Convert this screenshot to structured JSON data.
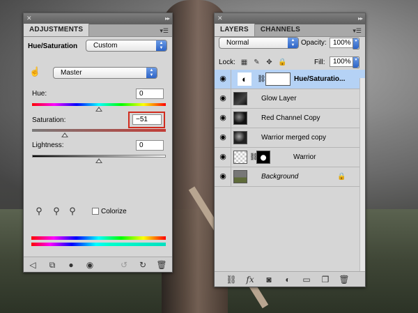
{
  "adjustments": {
    "tab_label": "ADJUSTMENTS",
    "title": "Hue/Saturation",
    "preset": "Custom",
    "channel": "Master",
    "hue": {
      "label": "Hue:",
      "value": "0",
      "slider": 0.5
    },
    "saturation": {
      "label": "Saturation:",
      "value": "−51",
      "slider": 0.245
    },
    "lightness": {
      "label": "Lightness:",
      "value": "0",
      "slider": 0.5
    },
    "colorize_label": "Colorize",
    "colorize_checked": false
  },
  "layers": {
    "tabs": [
      "LAYERS",
      "CHANNELS"
    ],
    "blend_mode": "Normal",
    "opacity_label": "Opacity:",
    "opacity": "100%",
    "lock_label": "Lock:",
    "fill_label": "Fill:",
    "fill": "100%",
    "items": [
      {
        "name": "Hue/Saturatio...",
        "selected": true,
        "italic": false
      },
      {
        "name": "Glow Layer",
        "selected": false,
        "italic": false
      },
      {
        "name": "Red Channel Copy",
        "selected": false,
        "italic": false
      },
      {
        "name": "Warrior merged copy",
        "selected": false,
        "italic": false
      },
      {
        "name": "Warrior",
        "selected": false,
        "italic": false
      },
      {
        "name": "Background",
        "selected": false,
        "italic": true
      }
    ]
  },
  "colors": {
    "selection": "#b5d2f5",
    "highlight_box": "#d12b1e",
    "panel_bg": "#d6d6d6"
  }
}
